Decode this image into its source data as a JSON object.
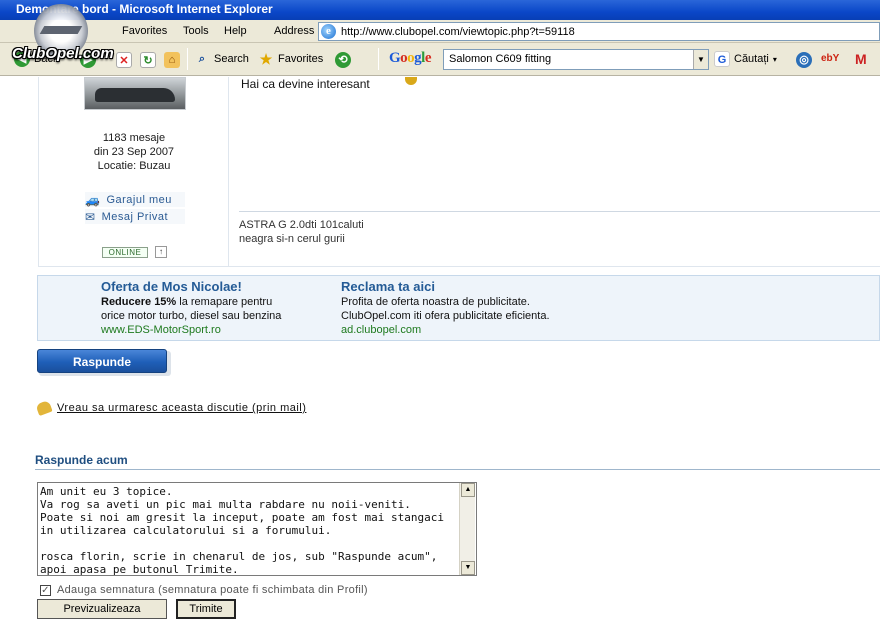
{
  "window": {
    "title": "Demontare bord - Microsoft Internet Explorer"
  },
  "logo": {
    "brand": "ClubOpel.com"
  },
  "menu": {
    "items": [
      "Favorites",
      "Tools",
      "Help"
    ],
    "address_label": "Address"
  },
  "address": {
    "url": "http://www.clubopel.com/viewtopic.php?t=59118"
  },
  "toolbar": {
    "back": "Back",
    "search": "Search",
    "favorites": "Favorites",
    "google_search_value": "Salomon C609 fitting",
    "cautati": "Căutați",
    "google_letters": [
      "G",
      "o",
      "o",
      "g",
      "l",
      "e"
    ]
  },
  "post": {
    "text": "Hai ca devine interesant",
    "stats": {
      "messages": "1183 mesaje",
      "joined": "din 23 Sep 2007",
      "location": "Locatie: Buzau"
    },
    "links": {
      "garage": "Garajul meu",
      "pm": "Mesaj Privat"
    },
    "online": "ONLINE",
    "up": "↑",
    "signature": [
      "ASTRA G 2.0dti 101caluti",
      "neagra si-n cerul gurii"
    ]
  },
  "ads": [
    {
      "title": "Oferta de Mos Nicolae!",
      "lead_bold": "Reducere 15%",
      "lead_rest": " la remapare pentru",
      "line2": "orice motor turbo, diesel sau benzina",
      "link": "www.EDS-MotorSport.ro"
    },
    {
      "title": "Reclama ta aici",
      "line1": "Profita de oferta noastra de publicitate.",
      "line2": "ClubOpel.com iti ofera publicitate eficienta.",
      "link": "ad.clubopel.com"
    }
  ],
  "reply_button": "Raspunde",
  "watch_link": "Vreau sa urmaresc aceasta discutie (prin mail)",
  "reply_section": {
    "title": "Raspunde acum",
    "textarea_value": "Am unit eu 3 topice.\nVa rog sa aveti un pic mai multa rabdare nu noii-veniti.\nPoate si noi am gresit la inceput, poate am fost mai stangaci in utilizarea calculatorului si a forumului.\n\nrosca florin, scrie in chenarul de jos, sub \"Raspunde acum\", apoi apasa pe butonul Trimite.",
    "signature_checkbox": "Adauga semnatura (semnatura poate fi schimbata din Profil)",
    "signature_checked": true,
    "preview_button": "Previzualizeaza",
    "submit_button": "Trimite"
  }
}
